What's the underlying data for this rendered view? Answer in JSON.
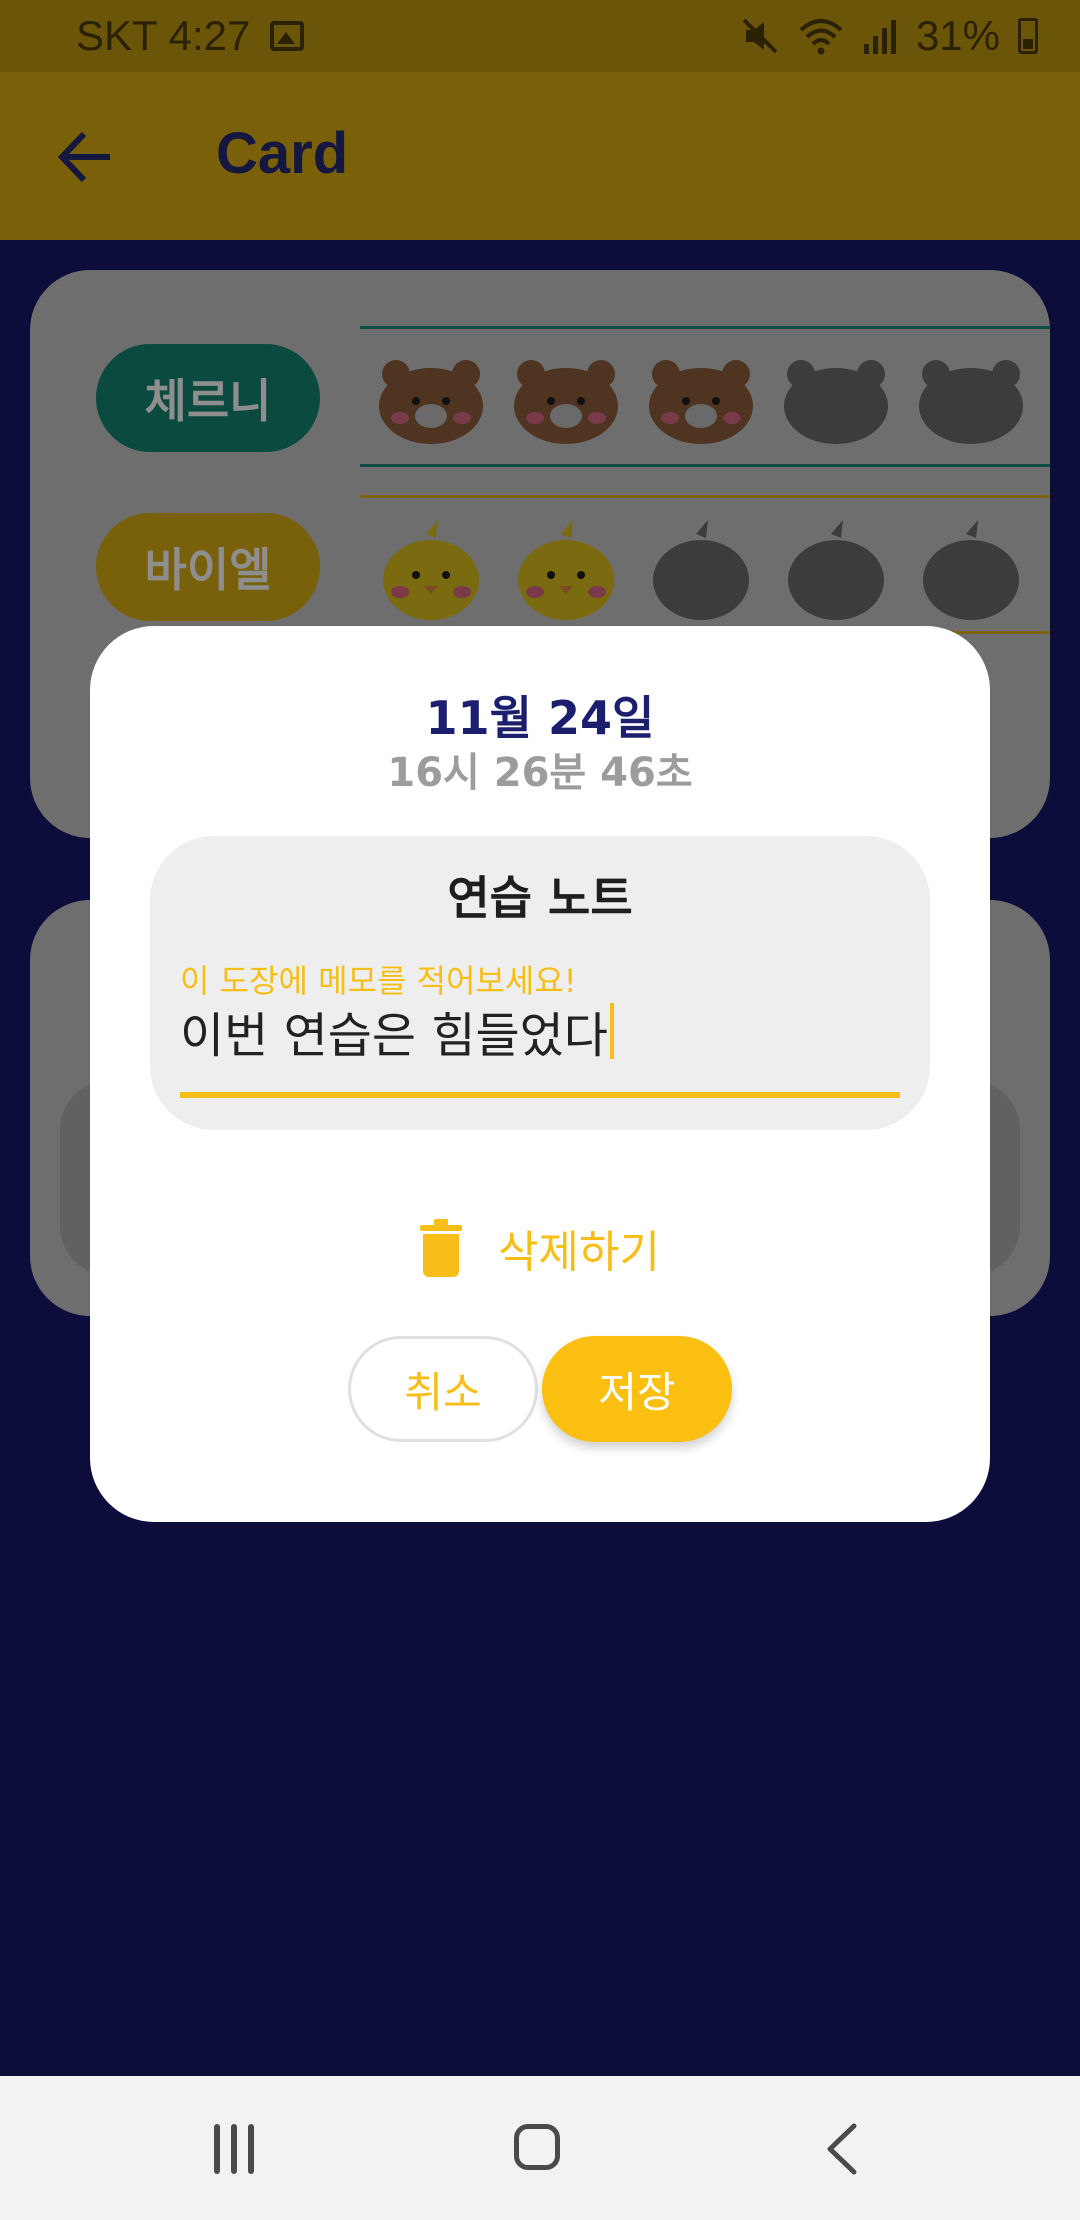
{
  "status_bar": {
    "carrier_time": "SKT 4:27",
    "battery": "31%",
    "icons": [
      "gallery-icon",
      "mute-icon",
      "wifi-icon",
      "signal-icon",
      "battery-icon"
    ]
  },
  "app_bar": {
    "title": "Card",
    "back_icon": "arrow-left-icon"
  },
  "background": {
    "rows": [
      {
        "name": "체르니",
        "sticker": "bear",
        "filled": 3,
        "total": 5,
        "color": "#0b4a3f"
      },
      {
        "name": "바이엘",
        "sticker": "chick",
        "filled": 2,
        "total": 5,
        "color": "#79600a"
      }
    ]
  },
  "dialog": {
    "date": "11월 24일",
    "time": "16시 26분 46초",
    "note_title": "연습 노트",
    "hint": "이 도장에 메모를 적어보세요!",
    "input_value": "이번 연습은 힘들었다",
    "delete_label": "삭제하기",
    "cancel_label": "취소",
    "save_label": "저장"
  },
  "colors": {
    "accent": "#f7be17",
    "navy": "#1b1f6e",
    "background": "#0c0d3a"
  }
}
